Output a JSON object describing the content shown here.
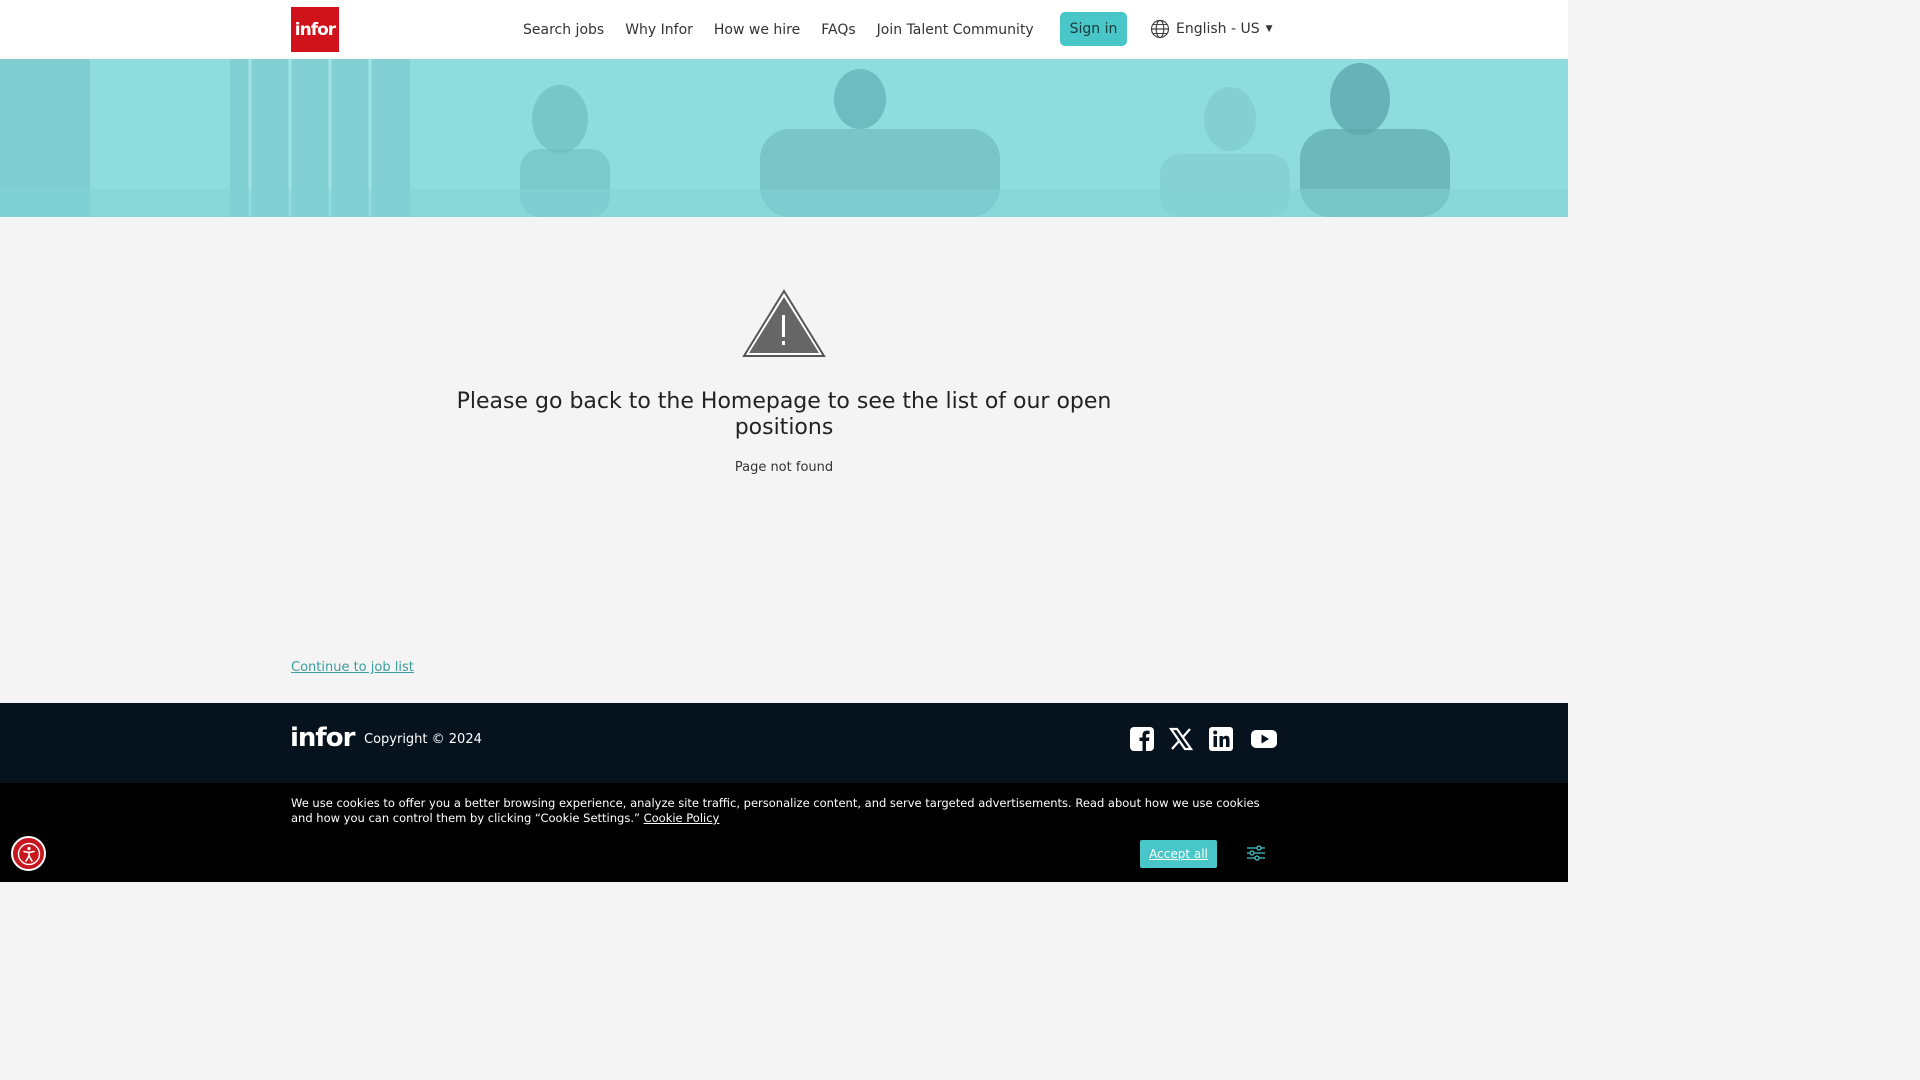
{
  "header": {
    "logo_text": "infor",
    "nav": [
      {
        "label": "Search jobs"
      },
      {
        "label": "Why Infor"
      },
      {
        "label": "How we hire"
      },
      {
        "label": "FAQs"
      },
      {
        "label": "Join Talent Community"
      }
    ],
    "sign_in": "Sign in",
    "language": "English - US"
  },
  "main": {
    "title": "Please go back to the Homepage to see the list of our open positions",
    "subtitle": "Page not found",
    "continue_link": "Continue to job list"
  },
  "footer": {
    "logo_text": "infor",
    "copyright": "Copyright © 2024",
    "social": [
      "facebook-icon",
      "x-icon",
      "linkedin-icon",
      "youtube-icon"
    ]
  },
  "cookie": {
    "text": "We use cookies to offer you a better browsing experience, analyze site traffic, personalize content, and serve targeted advertisements. Read about how we use cookies and how you can control them by clicking “Cookie Settings.”",
    "policy_link": "Cookie Policy",
    "accept": "Accept all"
  },
  "colors": {
    "brand_red": "#d0121a",
    "accent_teal": "#48c6c8",
    "footer_bg": "#06131f"
  }
}
